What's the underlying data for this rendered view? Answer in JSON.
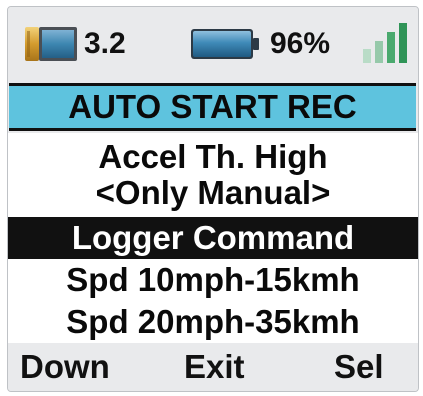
{
  "status": {
    "sd_value": "3.2",
    "battery_value": "96%",
    "icons": {
      "sd": "sd-card-icon",
      "battery": "battery-icon",
      "signal": "signal-strength-icon"
    }
  },
  "menu": {
    "title": "AUTO START REC",
    "items": [
      {
        "lines": [
          "Accel Th. High",
          "<Only Manual>"
        ]
      },
      {
        "label": "Logger Command",
        "selected": true
      },
      {
        "label": "Spd 10mph-15kmh"
      },
      {
        "label": "Spd 20mph-35kmh"
      }
    ]
  },
  "softkeys": {
    "left": "Down",
    "center": "Exit",
    "right": "Sel"
  },
  "colors": {
    "screen_bg": "#e9eaec",
    "header_bg": "#5ec3de",
    "selection_bg": "#111111",
    "selection_fg": "#ffffff",
    "icon_blue": "#3d86b0"
  }
}
